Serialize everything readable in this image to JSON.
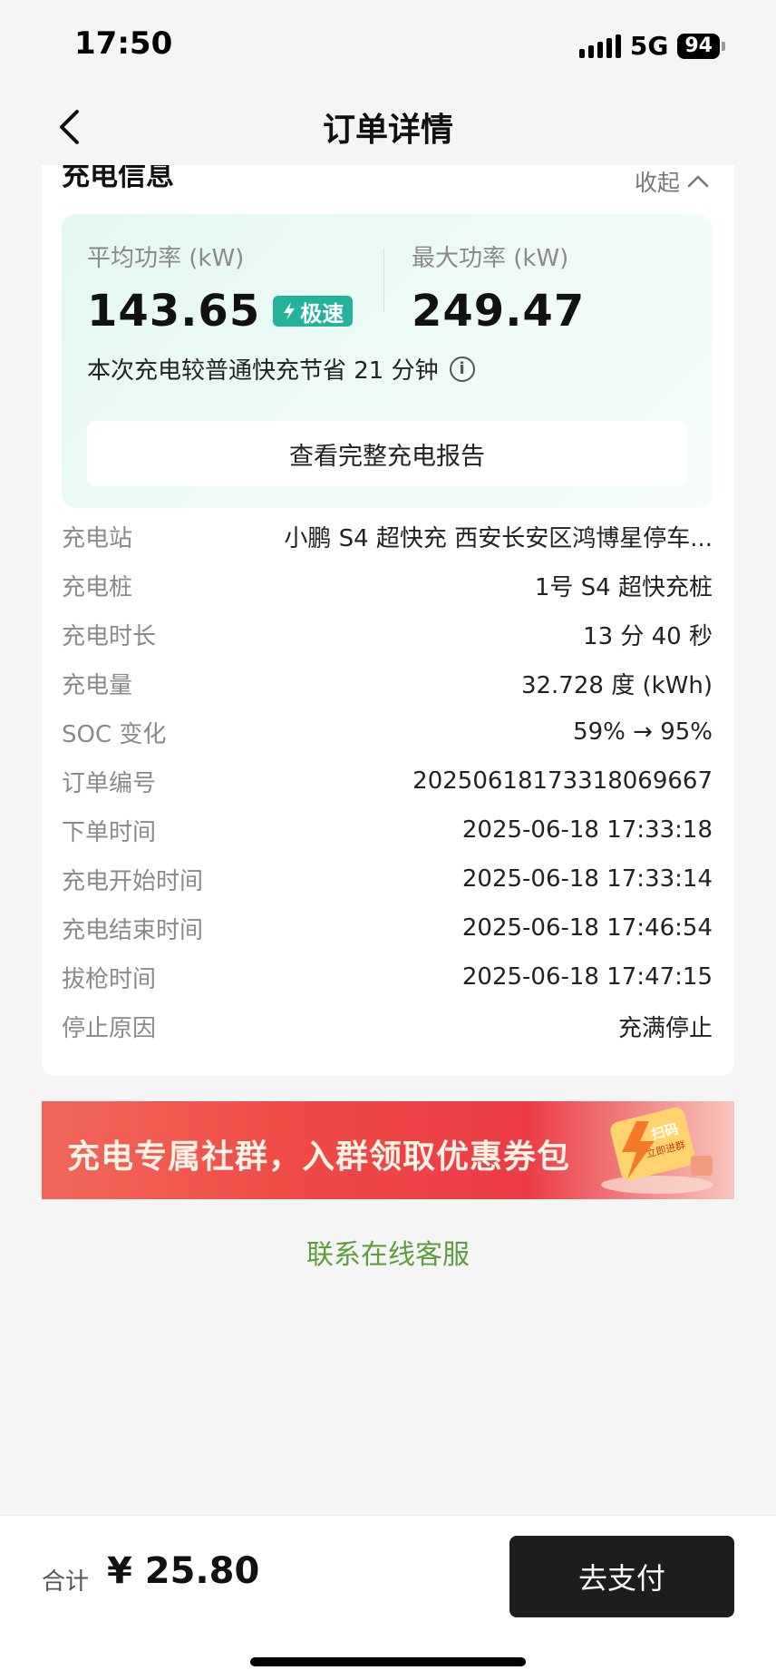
{
  "status_bar": {
    "time": "17:50",
    "network": "5G",
    "battery": "94"
  },
  "nav": {
    "title": "订单详情"
  },
  "charging_card": {
    "title": "充电信息",
    "collapse_label": "收起",
    "avg_power_label": "平均功率 (kW)",
    "avg_power_value": "143.65",
    "speed_badge": "极速",
    "max_power_label": "最大功率 (kW)",
    "max_power_value": "249.47",
    "savings_text": "本次充电较普通快充节省 21 分钟",
    "report_button": "查看完整充电报告",
    "details": [
      {
        "label": "充电站",
        "value": "小鹏 S4 超快充 西安长安区鸿博星停车..."
      },
      {
        "label": "充电桩",
        "value": "1号 S4 超快充桩"
      },
      {
        "label": "充电时长",
        "value": "13 分 40 秒"
      },
      {
        "label": "充电量",
        "value": "32.728 度 (kWh)"
      },
      {
        "label": "SOC 变化",
        "value": "59% → 95%"
      },
      {
        "label": "订单编号",
        "value": "20250618173318069667"
      },
      {
        "label": "下单时间",
        "value": "2025-06-18 17:33:18"
      },
      {
        "label": "充电开始时间",
        "value": "2025-06-18 17:33:14"
      },
      {
        "label": "充电结束时间",
        "value": "2025-06-18 17:46:54"
      },
      {
        "label": "拔枪时间",
        "value": "2025-06-18 17:47:15"
      },
      {
        "label": "停止原因",
        "value": "充满停止"
      }
    ]
  },
  "promo": {
    "text": "充电专属社群，入群领取优惠券包",
    "badge_top": "扫码",
    "badge_bottom": "立即进群"
  },
  "service_link": "联系在线客服",
  "bottom_bar": {
    "total_label": "合计",
    "total_amount": "¥ 25.80",
    "pay_button": "去支付"
  }
}
